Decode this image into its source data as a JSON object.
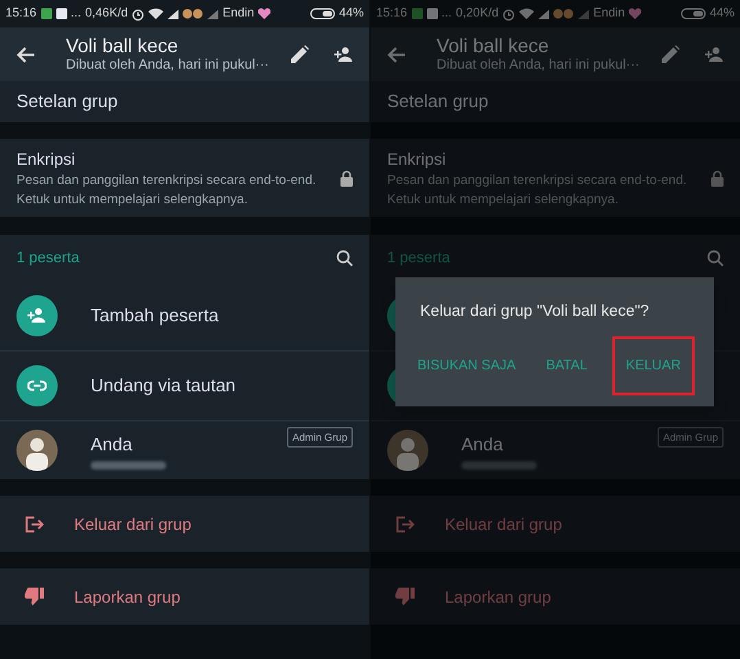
{
  "screens": [
    {
      "dimmed": false,
      "status_bar": {
        "time": "15:16",
        "dots": "...",
        "speed": "0,46K/d",
        "carrier": "Endin",
        "battery": "44%"
      },
      "header": {
        "title": "Voli ball kece",
        "subtitle": "Dibuat oleh Anda, hari ini pukul···"
      },
      "settings_label": "Setelan grup",
      "encryption": {
        "title": "Enkripsi",
        "text": "Pesan dan panggilan terenkripsi secara end-to-end. Ketuk untuk mempelajari selengkapnya."
      },
      "participants": {
        "count_label": "1 peserta",
        "actions": [
          {
            "kind": "add",
            "label": "Tambah peserta"
          },
          {
            "kind": "link",
            "label": "Undang via tautan"
          }
        ],
        "members": [
          {
            "name": "Anda",
            "badge": "Admin Grup"
          }
        ]
      },
      "menu": [
        {
          "kind": "exit",
          "label": "Keluar dari grup"
        },
        {
          "kind": "report",
          "label": "Laporkan grup"
        }
      ]
    },
    {
      "dimmed": true,
      "status_bar": {
        "time": "15:16",
        "dots": "...",
        "speed": "0,20K/d",
        "carrier": "Endin",
        "battery": "44%"
      },
      "header": {
        "title": "Voli ball kece",
        "subtitle": "Dibuat oleh Anda, hari ini pukul···"
      },
      "settings_label": "Setelan grup",
      "encryption": {
        "title": "Enkripsi",
        "text": "Pesan dan panggilan terenkripsi secara end-to-end. Ketuk untuk mempelajari selengkapnya."
      },
      "participants": {
        "count_label": "1 peserta",
        "actions": [
          {
            "kind": "add"
          },
          {
            "kind": "link"
          }
        ],
        "members": [
          {
            "name": "Anda",
            "badge": "Admin Grup"
          }
        ]
      },
      "menu": [
        {
          "kind": "exit",
          "label": "Keluar dari grup"
        },
        {
          "kind": "report",
          "label": "Laporkan grup"
        }
      ],
      "dialog": {
        "message": "Keluar dari grup \"Voli ball kece\"?",
        "buttons": [
          {
            "label": "BISUKAN SAJA",
            "highlighted": false
          },
          {
            "label": "BATAL",
            "highlighted": false
          },
          {
            "label": "KELUAR",
            "highlighted": true
          }
        ]
      }
    }
  ]
}
